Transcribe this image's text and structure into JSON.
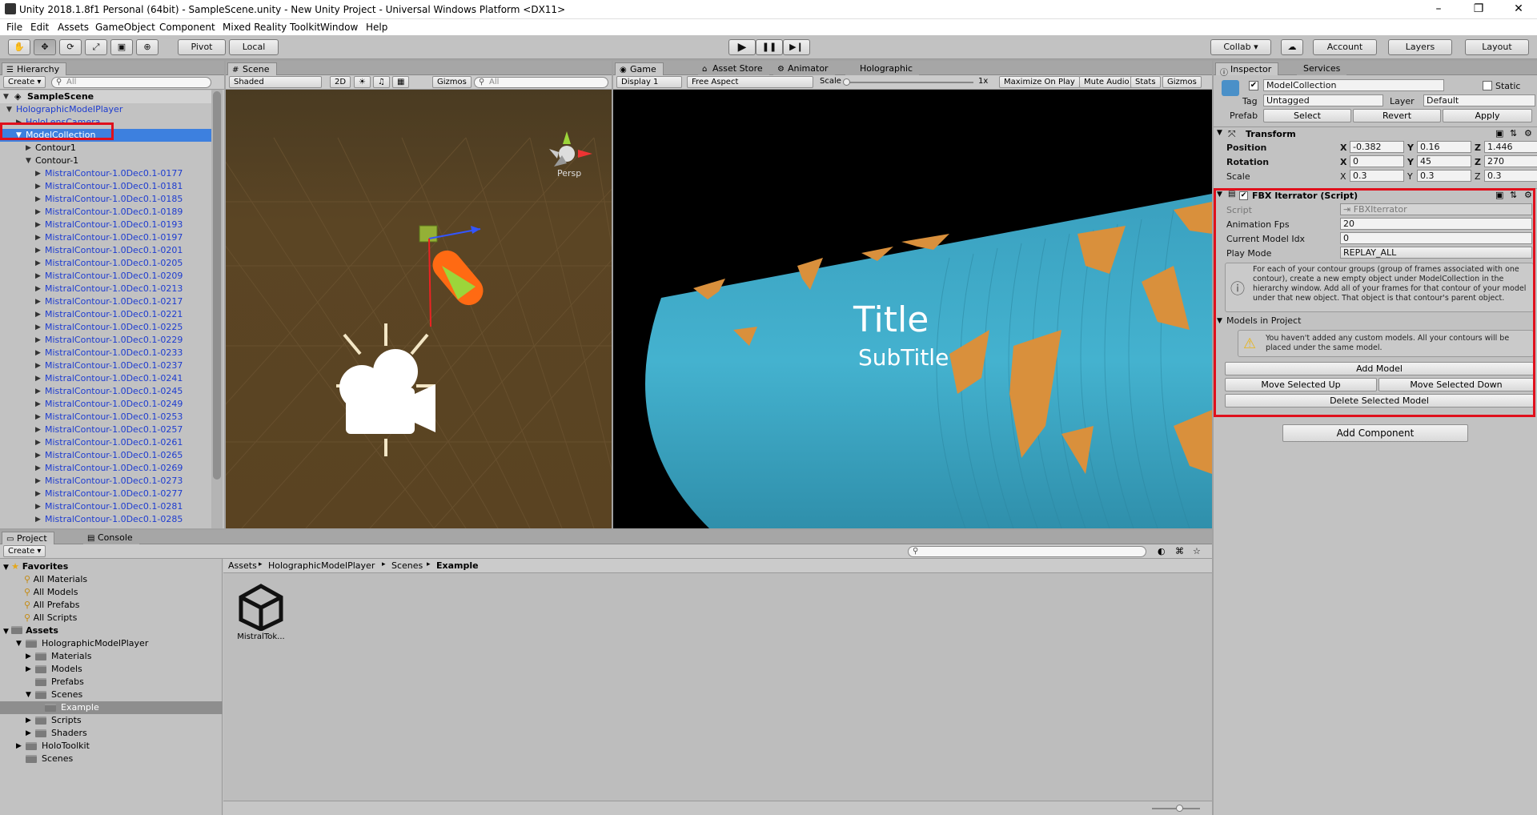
{
  "window": {
    "title": "Unity 2018.1.8f1 Personal (64bit) - SampleScene.unity - New Unity Project - Universal Windows Platform <DX11>",
    "minimize": "–",
    "maximize": "❐",
    "close": "✕"
  },
  "menu": [
    "File",
    "Edit",
    "Assets",
    "GameObject",
    "Component",
    "Mixed Reality Toolkit",
    "Window",
    "Help"
  ],
  "toolbar": {
    "tools": [
      "✋",
      "✥",
      "⟳",
      "⤢",
      "▣",
      "⊕"
    ],
    "pivot": "Pivot",
    "local": "Local",
    "play": "▶",
    "pause": "❚❚",
    "step": "▶❙",
    "collab": "Collab ▾",
    "cloud": "☁",
    "account": "Account",
    "layers": "Layers",
    "layout": "Layout"
  },
  "hierarchy": {
    "tab": "Hierarchy",
    "create": "Create ▾",
    "search_placeholder": "All",
    "scene": "SampleScene",
    "items": [
      {
        "label": "HolographicModelPlayer",
        "depth": 1,
        "arrow": "▼",
        "style": "blue"
      },
      {
        "label": "HoloLensCamera",
        "depth": 2,
        "arrow": "▶",
        "style": "blue"
      },
      {
        "label": "ModelCollection",
        "depth": 2,
        "arrow": "▼",
        "style": "selected"
      },
      {
        "label": "Contour1",
        "depth": 3,
        "arrow": "▶",
        "style": "plain"
      },
      {
        "label": "Contour-1",
        "depth": 3,
        "arrow": "▼",
        "style": "plain"
      },
      {
        "label": "MistralContour-1.0Dec0.1-0177",
        "depth": 4,
        "arrow": "▶",
        "style": "blue"
      },
      {
        "label": "MistralContour-1.0Dec0.1-0181",
        "depth": 4,
        "arrow": "▶",
        "style": "blue"
      },
      {
        "label": "MistralContour-1.0Dec0.1-0185",
        "depth": 4,
        "arrow": "▶",
        "style": "blue"
      },
      {
        "label": "MistralContour-1.0Dec0.1-0189",
        "depth": 4,
        "arrow": "▶",
        "style": "blue"
      },
      {
        "label": "MistralContour-1.0Dec0.1-0193",
        "depth": 4,
        "arrow": "▶",
        "style": "blue"
      },
      {
        "label": "MistralContour-1.0Dec0.1-0197",
        "depth": 4,
        "arrow": "▶",
        "style": "blue"
      },
      {
        "label": "MistralContour-1.0Dec0.1-0201",
        "depth": 4,
        "arrow": "▶",
        "style": "blue"
      },
      {
        "label": "MistralContour-1.0Dec0.1-0205",
        "depth": 4,
        "arrow": "▶",
        "style": "blue"
      },
      {
        "label": "MistralContour-1.0Dec0.1-0209",
        "depth": 4,
        "arrow": "▶",
        "style": "blue"
      },
      {
        "label": "MistralContour-1.0Dec0.1-0213",
        "depth": 4,
        "arrow": "▶",
        "style": "blue"
      },
      {
        "label": "MistralContour-1.0Dec0.1-0217",
        "depth": 4,
        "arrow": "▶",
        "style": "blue"
      },
      {
        "label": "MistralContour-1.0Dec0.1-0221",
        "depth": 4,
        "arrow": "▶",
        "style": "blue"
      },
      {
        "label": "MistralContour-1.0Dec0.1-0225",
        "depth": 4,
        "arrow": "▶",
        "style": "blue"
      },
      {
        "label": "MistralContour-1.0Dec0.1-0229",
        "depth": 4,
        "arrow": "▶",
        "style": "blue"
      },
      {
        "label": "MistralContour-1.0Dec0.1-0233",
        "depth": 4,
        "arrow": "▶",
        "style": "blue"
      },
      {
        "label": "MistralContour-1.0Dec0.1-0237",
        "depth": 4,
        "arrow": "▶",
        "style": "blue"
      },
      {
        "label": "MistralContour-1.0Dec0.1-0241",
        "depth": 4,
        "arrow": "▶",
        "style": "blue"
      },
      {
        "label": "MistralContour-1.0Dec0.1-0245",
        "depth": 4,
        "arrow": "▶",
        "style": "blue"
      },
      {
        "label": "MistralContour-1.0Dec0.1-0249",
        "depth": 4,
        "arrow": "▶",
        "style": "blue"
      },
      {
        "label": "MistralContour-1.0Dec0.1-0253",
        "depth": 4,
        "arrow": "▶",
        "style": "blue"
      },
      {
        "label": "MistralContour-1.0Dec0.1-0257",
        "depth": 4,
        "arrow": "▶",
        "style": "blue"
      },
      {
        "label": "MistralContour-1.0Dec0.1-0261",
        "depth": 4,
        "arrow": "▶",
        "style": "blue"
      },
      {
        "label": "MistralContour-1.0Dec0.1-0265",
        "depth": 4,
        "arrow": "▶",
        "style": "blue"
      },
      {
        "label": "MistralContour-1.0Dec0.1-0269",
        "depth": 4,
        "arrow": "▶",
        "style": "blue"
      },
      {
        "label": "MistralContour-1.0Dec0.1-0273",
        "depth": 4,
        "arrow": "▶",
        "style": "blue"
      },
      {
        "label": "MistralContour-1.0Dec0.1-0277",
        "depth": 4,
        "arrow": "▶",
        "style": "blue"
      },
      {
        "label": "MistralContour-1.0Dec0.1-0281",
        "depth": 4,
        "arrow": "▶",
        "style": "blue"
      },
      {
        "label": "MistralContour-1.0Dec0.1-0285",
        "depth": 4,
        "arrow": "▶",
        "style": "blue"
      }
    ]
  },
  "scene": {
    "tab": "Scene",
    "shading": "Shaded",
    "mode2d": "2D",
    "gizmos": "Gizmos",
    "search_placeholder": "All",
    "persp": "Persp",
    "axis_y": "y",
    "axis_x": "x"
  },
  "game": {
    "tabs": [
      "Game",
      "Asset Store",
      "Animator",
      "Holographic"
    ],
    "display": "Display 1",
    "aspect": "Free Aspect",
    "scale_label": "Scale",
    "scale_value": "1x",
    "maximize": "Maximize On Play",
    "mute": "Mute Audio",
    "stats": "Stats",
    "gizmos": "Gizmos",
    "title": "Title",
    "subtitle": "SubTitle",
    "colors": {
      "tube": "#3aa0bf",
      "patch": "#d9903c"
    }
  },
  "inspector": {
    "tabs": [
      "Inspector",
      "Services"
    ],
    "object_name": "ModelCollection",
    "static_label": "Static",
    "tag_label": "Tag",
    "tag_value": "Untagged",
    "layer_label": "Layer",
    "layer_value": "Default",
    "prefab_label": "Prefab",
    "prefab_select": "Select",
    "prefab_revert": "Revert",
    "prefab_apply": "Apply",
    "transform": {
      "title": "Transform",
      "position": {
        "label": "Position",
        "x": "-0.382",
        "y": "0.16",
        "z": "1.446"
      },
      "rotation": {
        "label": "Rotation",
        "x": "0",
        "y": "45",
        "z": "270"
      },
      "scale": {
        "label": "Scale",
        "x": "0.3",
        "y": "0.3",
        "z": "0.3"
      },
      "axes": [
        "X",
        "Y",
        "Z"
      ]
    },
    "script": {
      "title": "FBX Iterrator (Script)",
      "script_label": "Script",
      "script_value": "FBXIterrator",
      "fps_label": "Animation Fps",
      "fps_value": "20",
      "idx_label": "Current Model Idx",
      "idx_value": "0",
      "mode_label": "Play Mode",
      "mode_value": "REPLAY_ALL",
      "info": "For each of your contour groups (group of frames associated with one contour), create a new empty object under ModelCollection in the hierarchy window. Add all of your frames for that contour of your model under that new object. That object is that contour's parent object.",
      "models_label": "Models in Project",
      "warning": "You haven't added any custom models. All your contours will be placed under the same model.",
      "add_model": "Add Model",
      "move_up": "Move Selected Up",
      "move_down": "Move Selected Down",
      "delete": "Delete Selected Model"
    },
    "add_component": "Add Component"
  },
  "project": {
    "tabs": [
      "Project",
      "Console"
    ],
    "create": "Create ▾",
    "favorites_label": "Favorites",
    "favorites": [
      "All Materials",
      "All Models",
      "All Prefabs",
      "All Scripts"
    ],
    "assets_label": "Assets",
    "tree": [
      {
        "label": "HolographicModelPlayer",
        "depth": 1,
        "arrow": "▼"
      },
      {
        "label": "Materials",
        "depth": 2,
        "arrow": "▶"
      },
      {
        "label": "Models",
        "depth": 2,
        "arrow": "▶"
      },
      {
        "label": "Prefabs",
        "depth": 2,
        "arrow": ""
      },
      {
        "label": "Scenes",
        "depth": 2,
        "arrow": "▼"
      },
      {
        "label": "Example",
        "depth": 3,
        "arrow": "",
        "selected": true
      },
      {
        "label": "Scripts",
        "depth": 2,
        "arrow": "▶"
      },
      {
        "label": "Shaders",
        "depth": 2,
        "arrow": "▶"
      },
      {
        "label": "HoloToolkit",
        "depth": 1,
        "arrow": "▶"
      },
      {
        "label": "Scenes",
        "depth": 1,
        "arrow": ""
      }
    ],
    "breadcrumb": [
      "Assets",
      "HolographicModelPlayer",
      "Scenes",
      "Example"
    ],
    "breadcrumb_sep": "▸",
    "file_name": "MistralTok..."
  }
}
